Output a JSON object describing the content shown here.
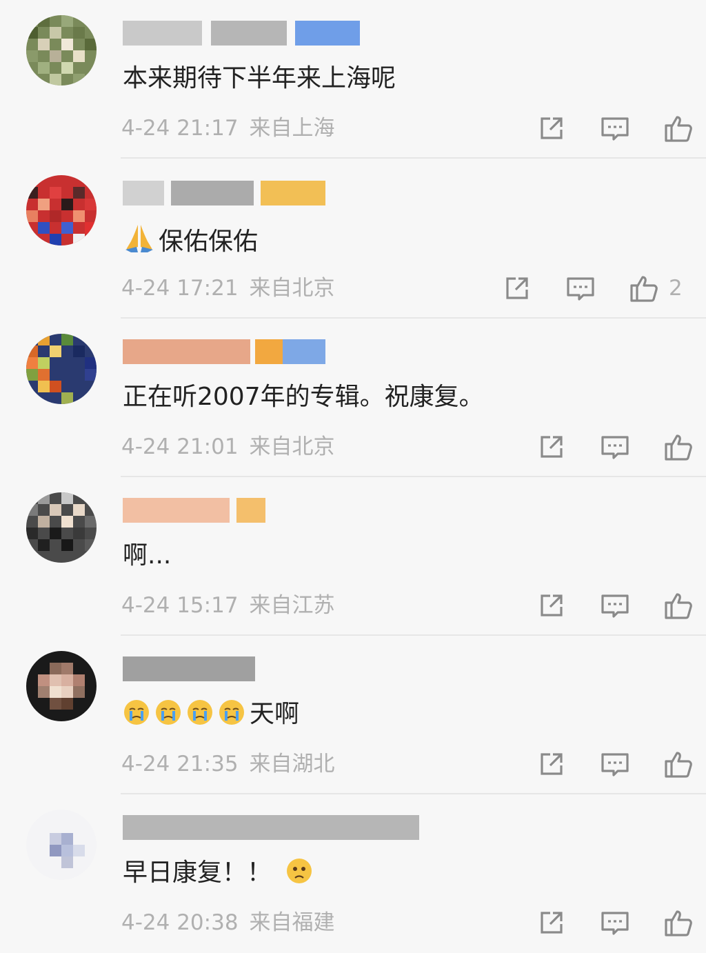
{
  "comments": [
    {
      "text": "本来期待下半年来上海呢",
      "time": "4-24 21:17",
      "location": "来自上海",
      "like_count": ""
    },
    {
      "text": "保佑保佑",
      "time": "4-24 17:21",
      "location": "来自北京",
      "like_count": "2"
    },
    {
      "text": "正在听2007年的专辑。祝康复。",
      "time": "4-24 21:01",
      "location": "来自北京",
      "like_count": ""
    },
    {
      "text": "啊...",
      "time": "4-24 15:17",
      "location": "来自江苏",
      "like_count": ""
    },
    {
      "text": "天啊",
      "time": "4-24 21:35",
      "location": "来自湖北",
      "like_count": ""
    },
    {
      "text": "早日康复！！",
      "time": "4-24 20:38",
      "location": "来自福建",
      "like_count": ""
    }
  ],
  "icons": {
    "repost": "share-square-icon",
    "comment": "comment-bubble-icon",
    "like": "thumbs-up-icon",
    "pray": "pray-emoji-icon",
    "cry": "crying-emoji-icon",
    "sad": "sad-emoji-icon"
  },
  "colors": {
    "background": "#f7f7f7",
    "text": "#222222",
    "meta": "#b0b0b0",
    "icon": "#8a8a8a",
    "divider": "#e6e6e6",
    "badge_blue": "#6f9ee8",
    "badge_gold": "#f2bf55"
  }
}
